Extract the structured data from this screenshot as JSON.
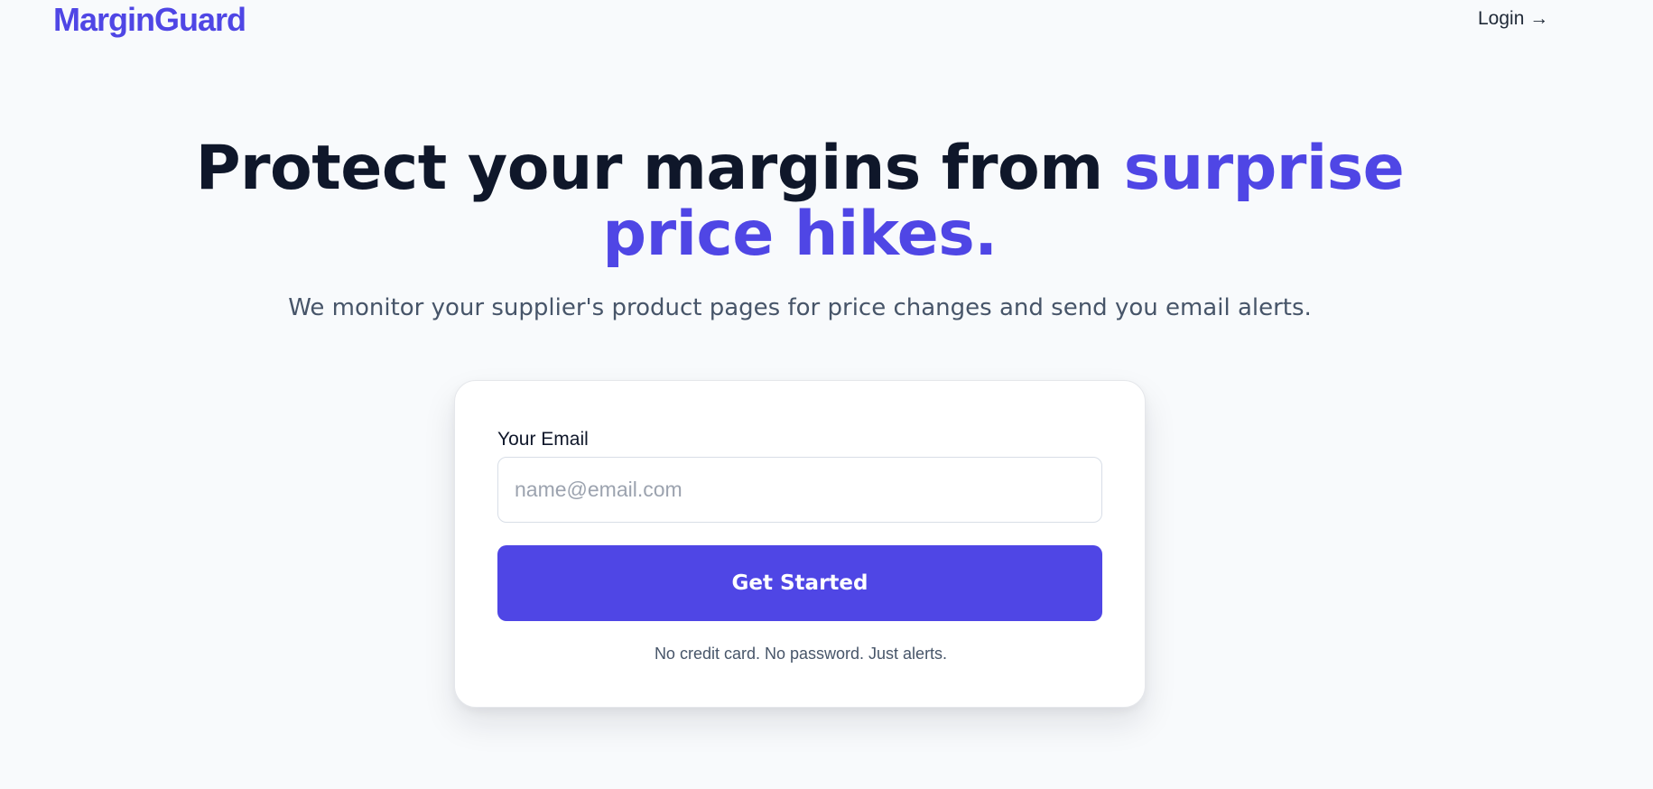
{
  "header": {
    "logo_text": "MarginGuard",
    "login_label": "Login →"
  },
  "hero": {
    "title_main": "Protect your margins from ",
    "title_accent_1": "surprise",
    "title_accent_2": "price hikes.",
    "subtitle": "We monitor your supplier's product pages for price changes and send you email alerts."
  },
  "signup": {
    "email_label": "Your Email",
    "email_placeholder": "name@email.com",
    "email_value": "",
    "button_label": "Get Started",
    "fine_print": "No credit card. No password. Just alerts."
  },
  "colors": {
    "brand": "#4f46e5",
    "heading": "#0f172a",
    "body_text": "#475569",
    "background": "#f8fafc"
  }
}
